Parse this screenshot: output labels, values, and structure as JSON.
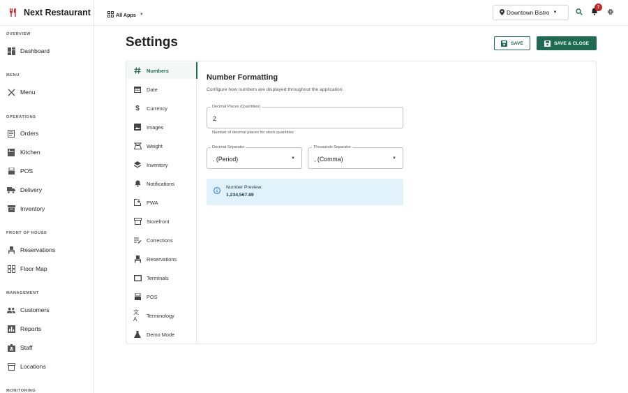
{
  "brand": {
    "name": "Next Restaurant",
    "icon": "fork-knife-icon",
    "accent": "#c62828"
  },
  "sidebar": {
    "sections": [
      {
        "label": "OVERVIEW",
        "items": [
          {
            "label": "Dashboard",
            "icon": "dashboard-icon"
          }
        ]
      },
      {
        "label": "MENU",
        "items": [
          {
            "label": "Menu",
            "icon": "menu-utensils-icon"
          }
        ]
      },
      {
        "label": "OPERATIONS",
        "items": [
          {
            "label": "Orders",
            "icon": "receipt-icon"
          },
          {
            "label": "Kitchen",
            "icon": "kitchen-icon"
          },
          {
            "label": "POS",
            "icon": "register-icon"
          },
          {
            "label": "Delivery",
            "icon": "truck-icon"
          },
          {
            "label": "Inventory",
            "icon": "inventory-box-icon"
          }
        ]
      },
      {
        "label": "FRONT OF HOUSE",
        "items": [
          {
            "label": "Reservations",
            "icon": "chair-icon"
          },
          {
            "label": "Floor Map",
            "icon": "grid-icon"
          }
        ]
      },
      {
        "label": "MANAGEMENT",
        "items": [
          {
            "label": "Customers",
            "icon": "people-icon"
          },
          {
            "label": "Reports",
            "icon": "chart-icon"
          },
          {
            "label": "Staff",
            "icon": "badge-icon"
          },
          {
            "label": "Locations",
            "icon": "store-icon"
          }
        ]
      },
      {
        "label": "MONITORING",
        "items": []
      }
    ]
  },
  "topbar": {
    "all_apps": "All Apps",
    "location": "Downtown Bistro",
    "notification_count": "7"
  },
  "page": {
    "title": "Settings",
    "save_label": "SAVE",
    "save_close_label": "SAVE & CLOSE",
    "primary_color": "#1f6b52"
  },
  "settings_nav": [
    {
      "label": "Numbers",
      "icon": "hash-icon",
      "active": true
    },
    {
      "label": "Date",
      "icon": "calendar-icon"
    },
    {
      "label": "Currency",
      "icon": "dollar-icon"
    },
    {
      "label": "Images",
      "icon": "image-icon"
    },
    {
      "label": "Weight",
      "icon": "scale-icon"
    },
    {
      "label": "Inventory",
      "icon": "layers-icon"
    },
    {
      "label": "Notifications",
      "icon": "bell-icon"
    },
    {
      "label": "PWA",
      "icon": "install-icon"
    },
    {
      "label": "Storefront",
      "icon": "storefront-icon"
    },
    {
      "label": "Corrections",
      "icon": "edit-list-icon"
    },
    {
      "label": "Reservations",
      "icon": "chair-icon"
    },
    {
      "label": "Terminals",
      "icon": "terminal-icon"
    },
    {
      "label": "POS",
      "icon": "register-icon"
    },
    {
      "label": "Terminology",
      "icon": "translate-icon"
    },
    {
      "label": "Demo Mode",
      "icon": "flask-icon"
    }
  ],
  "panel": {
    "title": "Number Formatting",
    "description": "Configure how numbers are displayed throughout the application.",
    "decimal_places": {
      "label": "Decimal Places (Quantities)",
      "value": "2",
      "helper": "Number of decimal places for stock quantities"
    },
    "decimal_separator": {
      "label": "Decimal Separator",
      "value": ". (Period)"
    },
    "thousands_separator": {
      "label": "Thousands Separator",
      "value": ", (Comma)"
    },
    "preview": {
      "label": "Number Preview:",
      "value": "1,234,567.89"
    }
  }
}
